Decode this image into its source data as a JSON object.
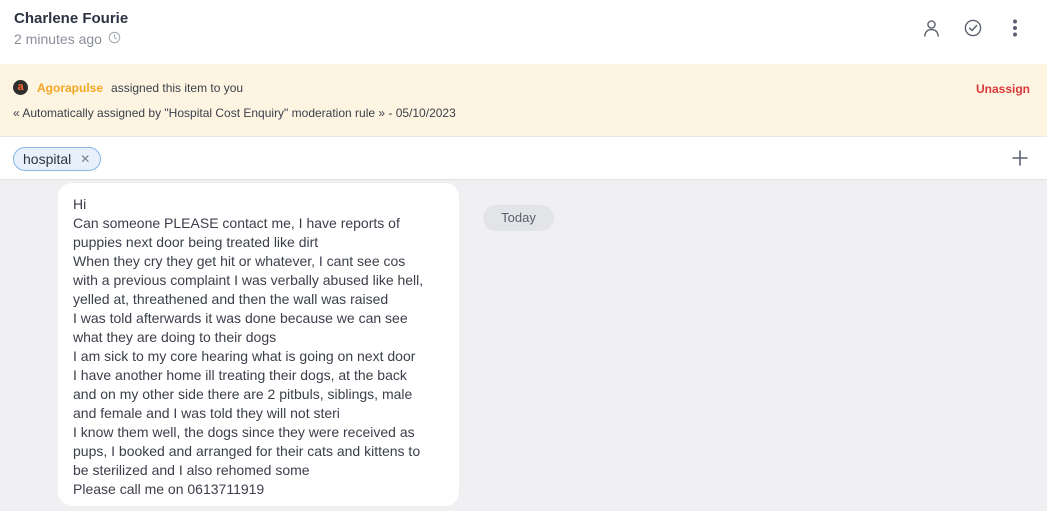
{
  "header": {
    "author": "Charlene Fourie",
    "time": "2 minutes ago"
  },
  "banner": {
    "logo_letter": "a",
    "brand": "Agorapulse",
    "assigned_text": "assigned this item to you",
    "rule_text": "« Automatically assigned by \"Hospital Cost Enquiry\" moderation rule » - 05/10/2023",
    "unassign_label": "Unassign"
  },
  "tags": [
    {
      "label": "hospital"
    }
  ],
  "message": {
    "lines": [
      "Hi",
      "Can someone PLEASE contact me, I have reports of",
      "puppies next door being treated like dirt",
      "When they cry they get hit or whatever, I cant see cos",
      "with a previous complaint I was verbally abused like hell,",
      "yelled at, threathened and then the wall was raised",
      "I was told afterwards it was done because we can see",
      "what they are doing to their dogs",
      "I am sick to my core hearing what is going on next door",
      "I have another home ill treating their dogs, at the back",
      "and on my other side there are 2 pitbuls, siblings, male",
      "and female and I was told they will not steri",
      "I know them well, the dogs since they were received as",
      "pups, I booked and arranged for their cats and kittens to",
      "be sterilized and I also rehomed some",
      "Please call me on 0613711919"
    ]
  },
  "date_separator": "Today",
  "icons": {
    "clock": "clock-icon",
    "assign": "user-icon",
    "resolve": "check-circle-icon",
    "more": "more-vertical-icon",
    "remove_tag": "close-icon",
    "add_tag": "plus-icon"
  },
  "colors": {
    "brand": "#f5a623",
    "unassign": "#d9383a",
    "banner_bg": "#fdf5e2",
    "tag_border": "#86b6e8",
    "tag_bg": "#e8f1fb"
  }
}
